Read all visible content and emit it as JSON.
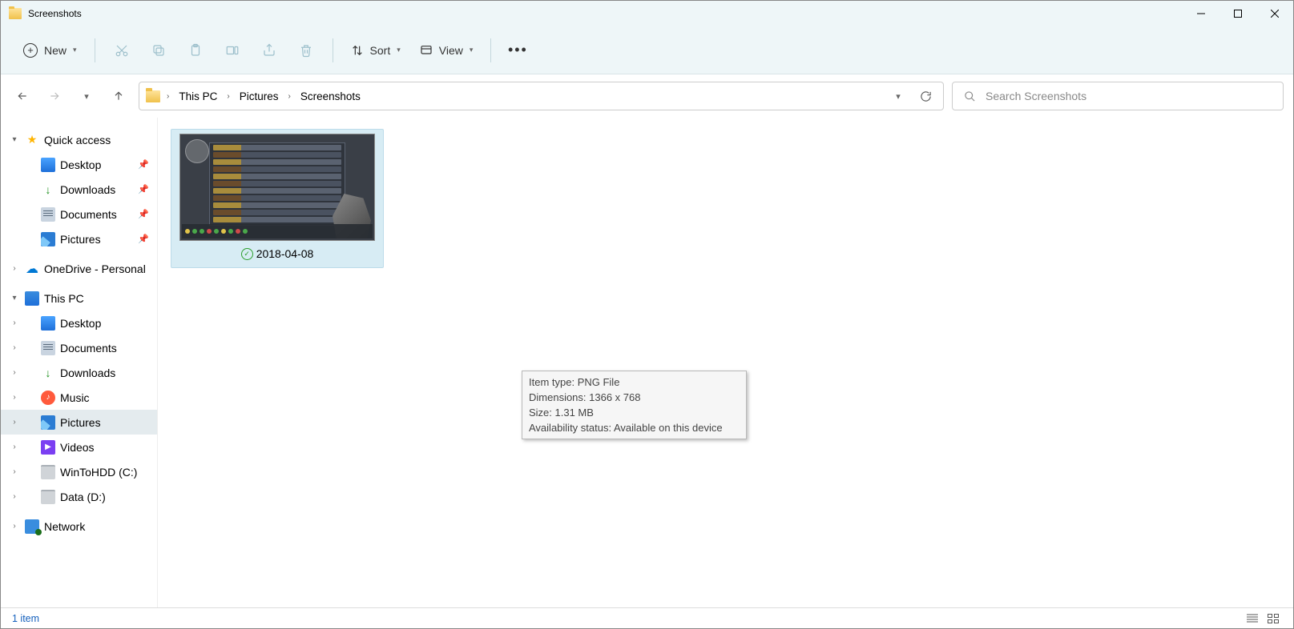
{
  "window": {
    "title": "Screenshots"
  },
  "toolbar": {
    "new_label": "New",
    "sort_label": "Sort",
    "view_label": "View"
  },
  "breadcrumb": {
    "items": [
      "This PC",
      "Pictures",
      "Screenshots"
    ]
  },
  "search": {
    "placeholder": "Search Screenshots"
  },
  "sidebar": {
    "quick_access": "Quick access",
    "qa_items": [
      {
        "label": "Desktop",
        "pin": true,
        "ico": "desktop"
      },
      {
        "label": "Downloads",
        "pin": true,
        "ico": "downloads"
      },
      {
        "label": "Documents",
        "pin": true,
        "ico": "docs"
      },
      {
        "label": "Pictures",
        "pin": true,
        "ico": "pics"
      }
    ],
    "onedrive": "OneDrive - Personal",
    "this_pc": "This PC",
    "pc_items": [
      {
        "label": "Desktop",
        "ico": "desktop"
      },
      {
        "label": "Documents",
        "ico": "docs"
      },
      {
        "label": "Downloads",
        "ico": "downloads"
      },
      {
        "label": "Music",
        "ico": "music"
      },
      {
        "label": "Pictures",
        "ico": "pics",
        "selected": true
      },
      {
        "label": "Videos",
        "ico": "videos"
      },
      {
        "label": "WinToHDD (C:)",
        "ico": "drive"
      },
      {
        "label": "Data (D:)",
        "ico": "drive"
      }
    ],
    "network": "Network"
  },
  "file": {
    "name": "2018-04-08"
  },
  "tooltip": {
    "line1": "Item type: PNG File",
    "line2": "Dimensions: 1366 x 768",
    "line3": "Size: 1.31 MB",
    "line4": "Availability status: Available on this device"
  },
  "statusbar": {
    "count": "1 item"
  }
}
